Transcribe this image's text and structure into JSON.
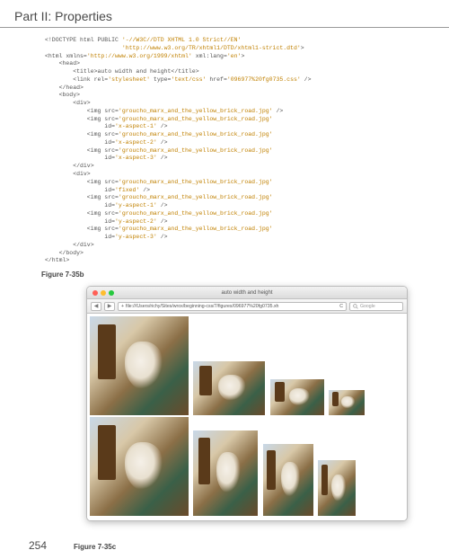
{
  "header": {
    "title": "Part II: Properties"
  },
  "code": {
    "line01a": "<!DOCTYPE html PUBLIC ",
    "line01b": "'-//W3C//DTD XHTML 1.0 Strict//EN'",
    "line02a": "                      ",
    "line02b": "'http://www.w3.org/TR/xhtml1/DTD/xhtml1-strict.dtd'",
    "line02c": ">",
    "line03a": "<html xmlns=",
    "line03b": "'http://www.w3.org/1999/xhtml'",
    "line03c": " xml:lang=",
    "line03d": "'en'",
    "line03e": ">",
    "line04": "    <head>",
    "line05": "        <title>auto width and height</title>",
    "line06a": "        <link rel=",
    "line06b": "'stylesheet'",
    "line06c": " type=",
    "line06d": "'text/css'",
    "line06e": " href=",
    "line06f": "'096977%20fg0735.css'",
    "line06g": " />",
    "line07": "    </head>",
    "line08": "    <body>",
    "line09": "        <div>",
    "line10a": "            <img src=",
    "line10b": "'groucho_marx_and_the_yellow_brick_road.jpg'",
    "line10c": " />",
    "line11a": "            <img src=",
    "line11b": "'groucho_marx_and_the_yellow_brick_road.jpg'",
    "line12a": "                 id=",
    "line12b": "'x-aspect-1'",
    "line12c": " />",
    "line13a": "            <img src=",
    "line13b": "'groucho_marx_and_the_yellow_brick_road.jpg'",
    "line14a": "                 id=",
    "line14b": "'x-aspect-2'",
    "line14c": " />",
    "line15a": "            <img src=",
    "line15b": "'groucho_marx_and_the_yellow_brick_road.jpg'",
    "line16a": "                 id=",
    "line16b": "'x-aspect-3'",
    "line16c": " />",
    "line17": "        </div>",
    "line18": "        <div>",
    "line19a": "            <img src=",
    "line19b": "'groucho_marx_and_the_yellow_brick_road.jpg'",
    "line20a": "                 id=",
    "line20b": "'fixed'",
    "line20c": " />",
    "line21a": "            <img src=",
    "line21b": "'groucho_marx_and_the_yellow_brick_road.jpg'",
    "line22a": "                 id=",
    "line22b": "'y-aspect-1'",
    "line22c": " />",
    "line23a": "            <img src=",
    "line23b": "'groucho_marx_and_the_yellow_brick_road.jpg'",
    "line24a": "                 id=",
    "line24b": "'y-aspect-2'",
    "line24c": " />",
    "line25a": "            <img src=",
    "line25b": "'groucho_marx_and_the_yellow_brick_road.jpg'",
    "line26a": "                 id=",
    "line26b": "'y-aspect-3'",
    "line26c": " />",
    "line27": "        </div>",
    "line28": "    </body>",
    "line29": "</html>"
  },
  "figure_b": "Figure 7-35b",
  "browser": {
    "title": "auto width and height",
    "nav_back": "◀",
    "nav_fwd": "▶",
    "url_icon": "+",
    "url": "file:///Users/richy/Sites/wrox/beginning-css/7/figures/096977%20fg0735.xh",
    "reload": "C",
    "search_placeholder": "Google"
  },
  "figure_c": "Figure 7-35c",
  "page_number": "254"
}
